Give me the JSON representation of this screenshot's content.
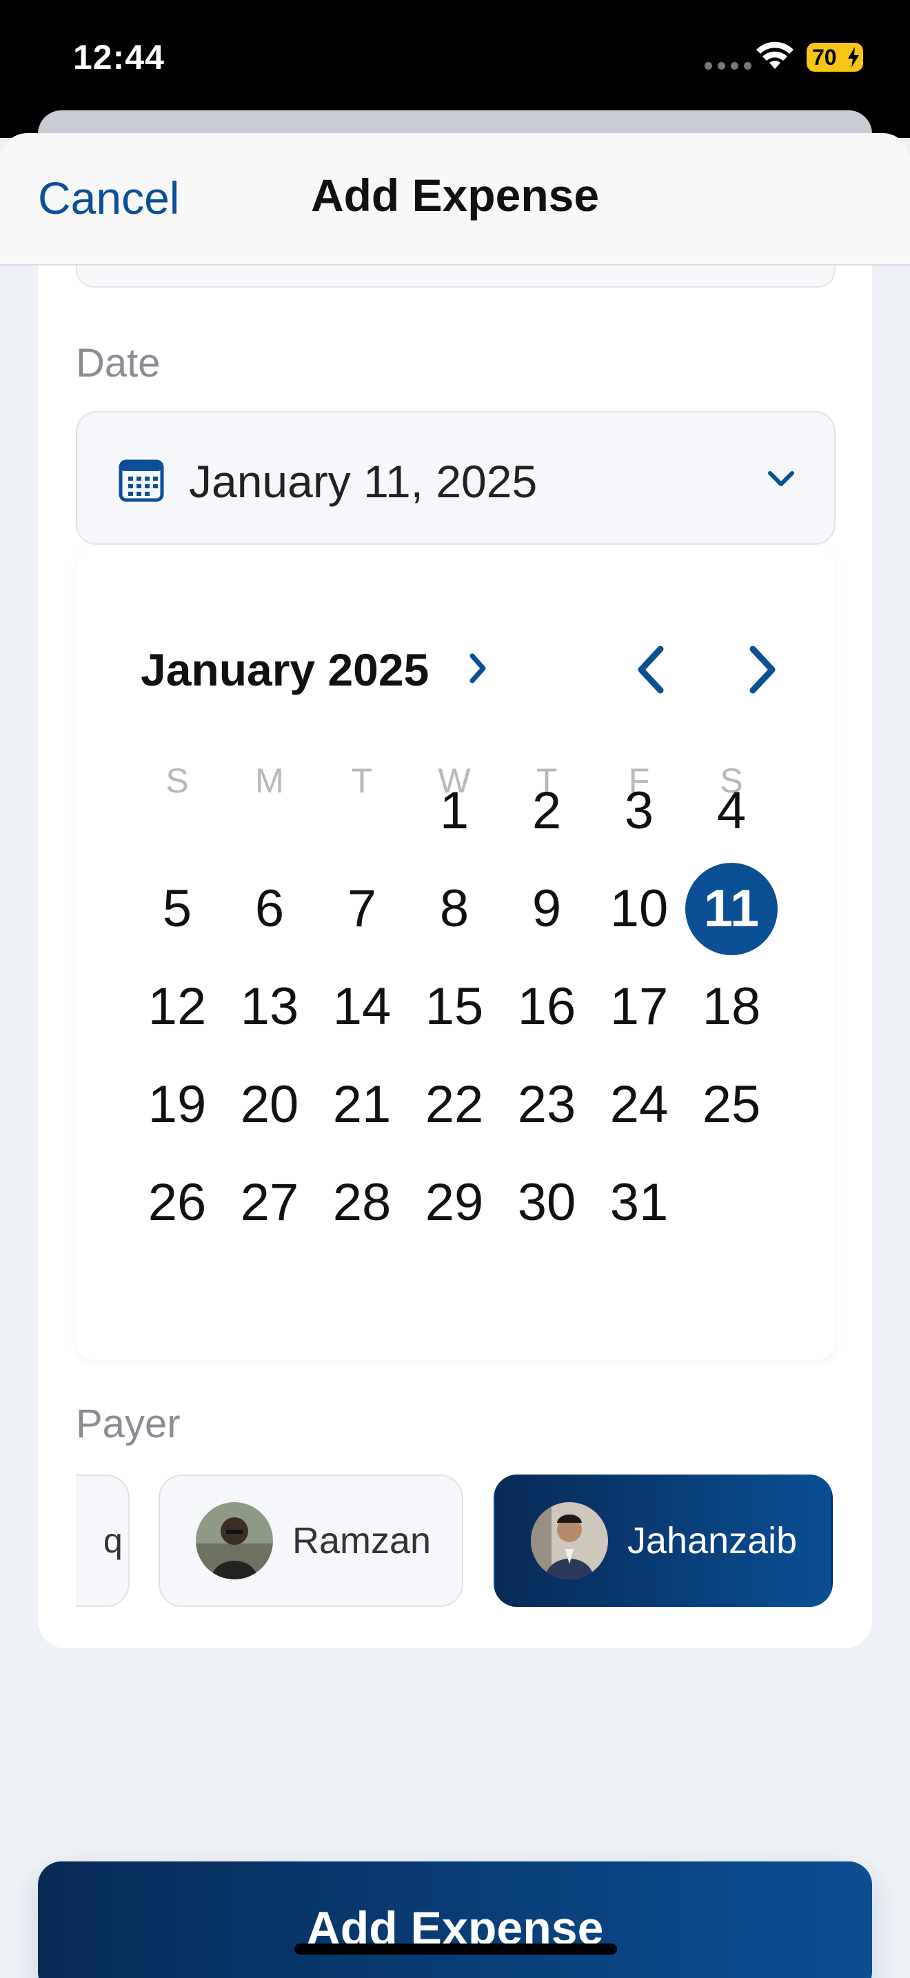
{
  "status_bar": {
    "time": "12:44",
    "battery": "70"
  },
  "nav": {
    "cancel": "Cancel",
    "title": "Add Expense"
  },
  "date": {
    "label": "Date",
    "value": "January 11, 2025"
  },
  "calendar": {
    "month_year": "January 2025",
    "weekdays": [
      "S",
      "M",
      "T",
      "W",
      "T",
      "F",
      "S"
    ],
    "first_weekday_index": 3,
    "days_in_month": 31,
    "selected_day": 11
  },
  "payer": {
    "label": "Payer",
    "partial_chip_text": "q",
    "options": [
      {
        "name": "Ramzan",
        "selected": false
      },
      {
        "name": "Jahanzaib",
        "selected": true
      }
    ]
  },
  "submit": {
    "label": "Add Expense"
  },
  "colors": {
    "accent": "#0b4f95",
    "accent_dark": "#072a55"
  }
}
